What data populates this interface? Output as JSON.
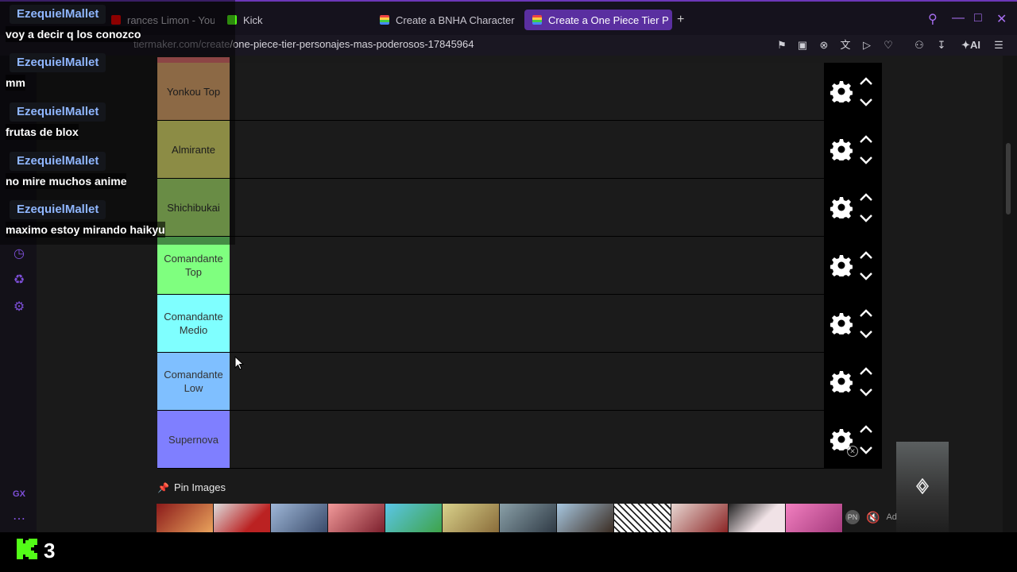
{
  "browser": {
    "tabs": [
      {
        "label": "rances Limon - YouTu",
        "active": false,
        "favicon_color": "#ff0000"
      },
      {
        "label": "Kick",
        "active": false,
        "favicon_color": "#53fc18"
      },
      {
        "label": "Create a BNHA Character",
        "active": false,
        "favicon_color": "#d9d9d9"
      },
      {
        "label": "Create a One Piece Tier P",
        "active": true,
        "favicon_color": "#d9d9d9"
      }
    ],
    "new_tab": "+",
    "url_domain": "tiermaker.com/create",
    "url_path": "/one-piece-tier-personajes-mas-poderosos-17845964",
    "ai_label": "AI"
  },
  "tiers": [
    {
      "label": "Yonkou Top",
      "color": "#ffbf7f"
    },
    {
      "label": "Almirante",
      "color": "#ffff7f"
    },
    {
      "label": "Shichibukai",
      "color": "#bfff7f"
    },
    {
      "label": "Comandante Top",
      "color": "#7fff7f"
    },
    {
      "label": "Comandante Medio",
      "color": "#7fffff"
    },
    {
      "label": "Comandante Low",
      "color": "#7fbfff"
    },
    {
      "label": "Supernova",
      "color": "#7f7fff"
    }
  ],
  "pin_images": "Pin Images",
  "ad_label": "Ad",
  "chat": [
    {
      "user": "EzequielMallet",
      "message": "voy a decir q los conozco"
    },
    {
      "user": "EzequielMallet",
      "message": "mm"
    },
    {
      "user": "EzequielMallet",
      "message": "frutas de blox"
    },
    {
      "user": "EzequielMallet",
      "message": "no mire muchos anime"
    },
    {
      "user": "EzequielMallet",
      "message": "maximo estoy mirando haikyu"
    }
  ],
  "gx_label": "GX",
  "viewer_count": "3",
  "colors": {
    "accent": "#6b37b8",
    "kick_green": "#53fc18"
  }
}
